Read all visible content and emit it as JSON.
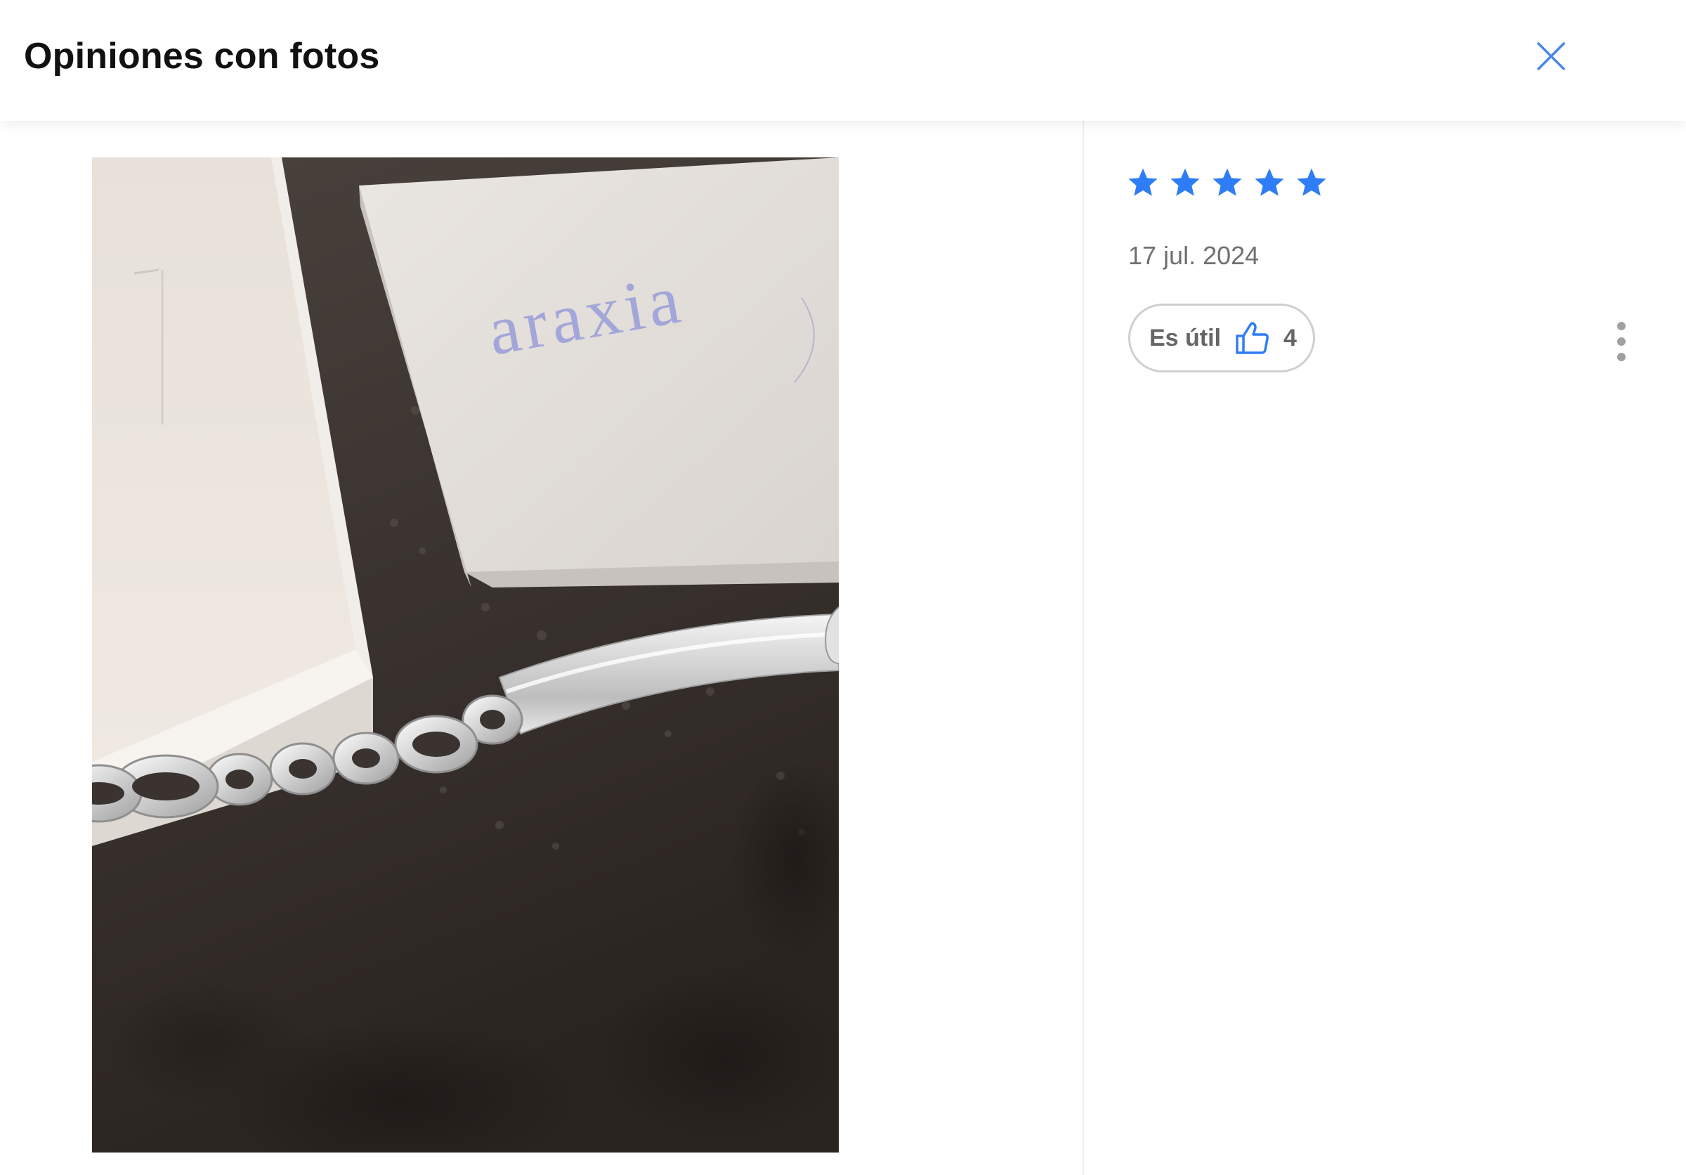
{
  "header": {
    "title": "Opiniones con fotos",
    "close_icon": "close-icon"
  },
  "review": {
    "rating": 5,
    "rating_max": 5,
    "star_color": "#2f7df6",
    "date": "17 jul. 2024",
    "useful": {
      "label": "Es útil",
      "icon": "thumbs-up-icon",
      "count": "4"
    },
    "more_icon": "more-vertical-icon"
  },
  "photo": {
    "brand_logo_text": "Araxia"
  },
  "colors": {
    "accent": "#2f7df6",
    "text_primary": "#111111",
    "text_secondary": "#707070",
    "border": "#cfcfcf"
  }
}
